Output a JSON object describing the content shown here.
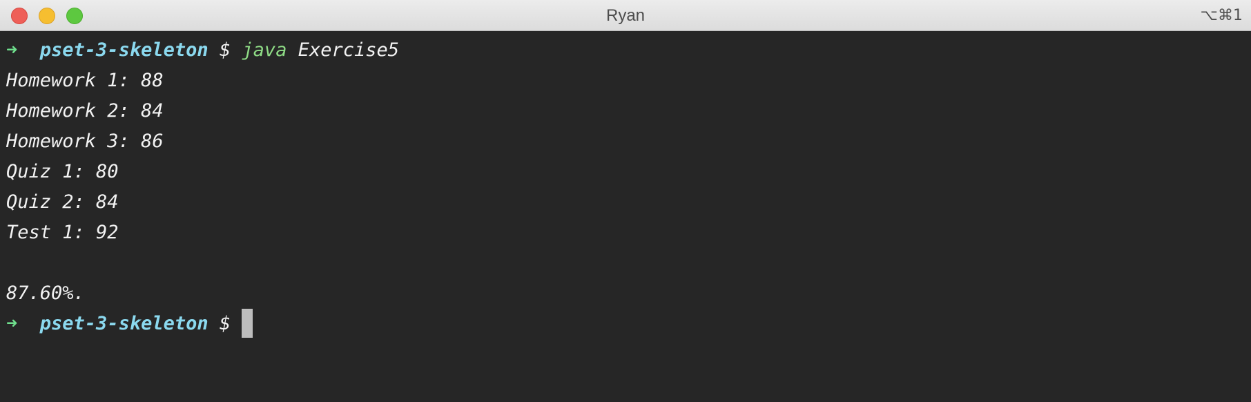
{
  "window": {
    "title": "Ryan",
    "shortcut": "⌥⌘1"
  },
  "terminal": {
    "prompt": {
      "arrow": "➜",
      "directory": "pset-3-skeleton",
      "symbol": "$"
    },
    "command": {
      "program": "java",
      "argument": "Exercise5"
    },
    "output": [
      "Homework 1: 88",
      "Homework 2: 84",
      "Homework 3: 86",
      "Quiz 1: 80",
      "Quiz 2: 84",
      "Test 1: 92",
      "",
      "87.60%."
    ]
  },
  "colors": {
    "background": "#262626",
    "arrow": "#6fdf8d",
    "directory": "#8bd9ef",
    "command": "#8fdc86",
    "text": "#f2f2f2",
    "cursor": "#bdbdbd"
  },
  "icons": [
    "close-button",
    "minimize-button",
    "maximize-button"
  ]
}
